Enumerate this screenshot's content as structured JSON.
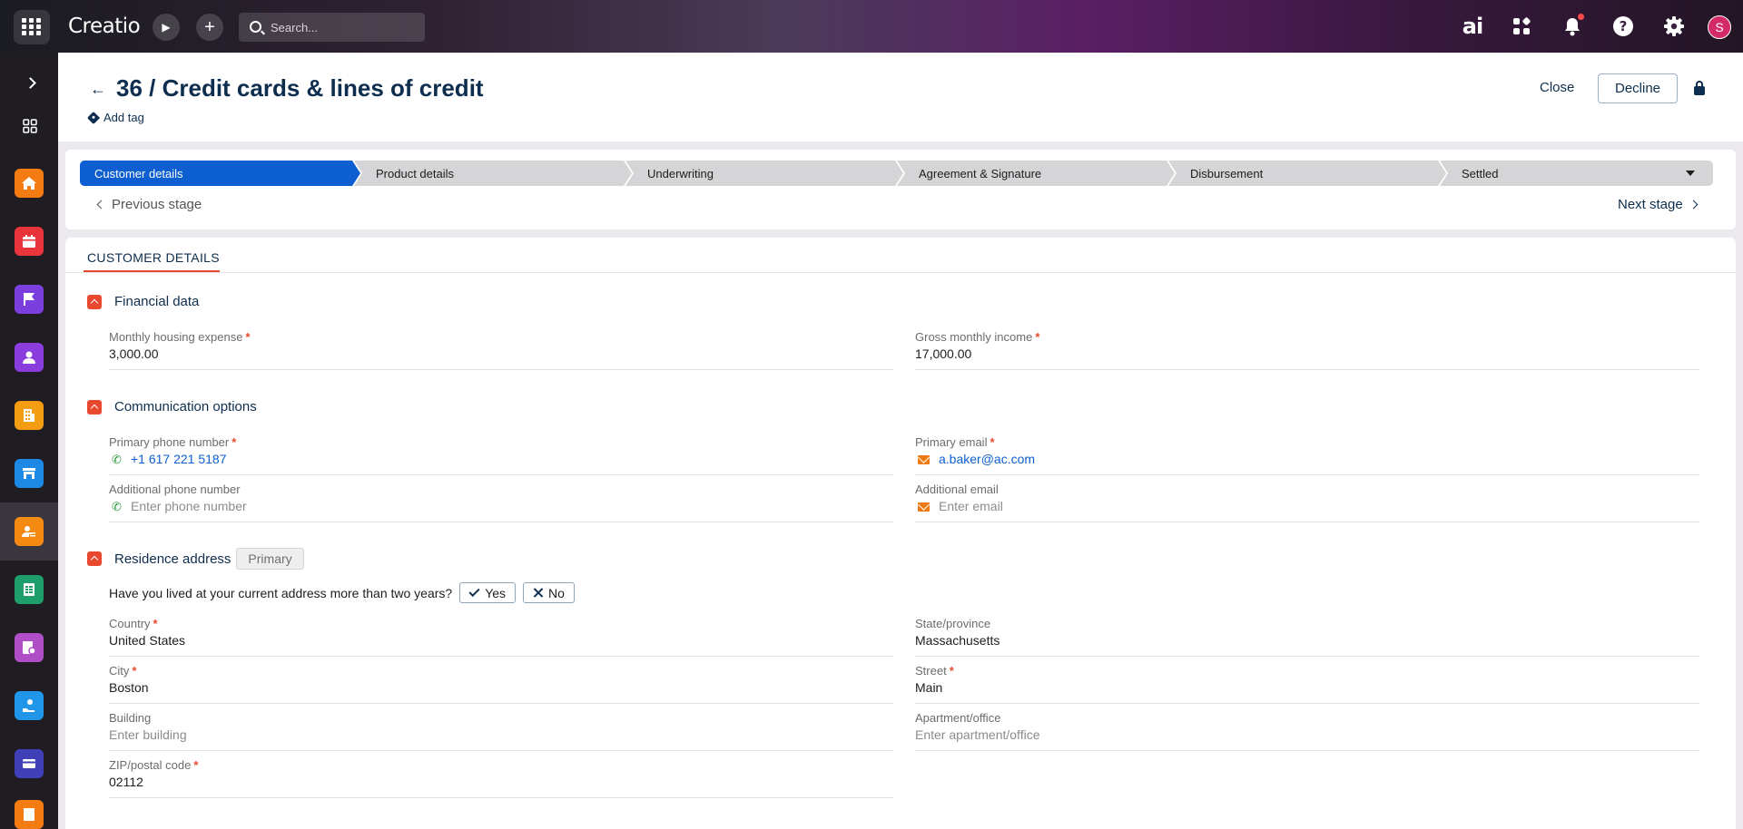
{
  "app": {
    "logo": "Creatio"
  },
  "topbar": {
    "search_placeholder": "Search...",
    "ai_label": "ai",
    "avatar_initial": "S"
  },
  "header": {
    "title": "36 / Credit cards & lines of credit",
    "add_tag": "Add tag",
    "close_label": "Close",
    "decline_label": "Decline"
  },
  "stages": {
    "items": [
      {
        "label": "Customer details",
        "active": true
      },
      {
        "label": "Product details",
        "active": false
      },
      {
        "label": "Underwriting",
        "active": false
      },
      {
        "label": "Agreement & Signature",
        "active": false
      },
      {
        "label": "Disbursement",
        "active": false
      },
      {
        "label": "Settled",
        "active": false
      }
    ],
    "previous": "Previous stage",
    "next": "Next stage"
  },
  "tab": {
    "label": "CUSTOMER DETAILS"
  },
  "sections": {
    "financial": {
      "title": "Financial data",
      "monthly_housing_label": "Monthly housing expense",
      "monthly_housing_value": "3,000.00",
      "gross_income_label": "Gross monthly income",
      "gross_income_value": "17,000.00"
    },
    "communication": {
      "title": "Communication options",
      "primary_phone_label": "Primary phone number",
      "primary_phone_value": "+1 617 221 5187",
      "primary_email_label": "Primary email",
      "primary_email_value": "a.baker@ac.com",
      "additional_phone_label": "Additional phone number",
      "additional_phone_placeholder": "Enter phone number",
      "additional_email_label": "Additional email",
      "additional_email_placeholder": "Enter email"
    },
    "residence": {
      "title": "Residence address",
      "badge": "Primary",
      "question": "Have you lived at your current address more than two years?",
      "yes_label": "Yes",
      "no_label": "No",
      "country_label": "Country",
      "country_value": "United States",
      "state_label": "State/province",
      "state_value": "Massachusetts",
      "city_label": "City",
      "city_value": "Boston",
      "street_label": "Street",
      "street_value": "Main",
      "building_label": "Building",
      "building_placeholder": "Enter building",
      "apartment_label": "Apartment/office",
      "apartment_placeholder": "Enter apartment/office",
      "zip_label": "ZIP/postal code",
      "zip_value": "02112"
    }
  },
  "colors": {
    "accent": "#e8482d",
    "stage_active": "#0d5fd1",
    "title_navy": "#0d2e4e",
    "sidebar_tiles": [
      "#f57c12",
      "#e8343a",
      "#7b3fe0",
      "#8a3ddc",
      "#f59d12",
      "#1e88e5",
      "#f58a12",
      "#1e9e6a",
      "#b04ec8",
      "#2196e8",
      "#3f3fb8",
      "#f57c12"
    ]
  }
}
